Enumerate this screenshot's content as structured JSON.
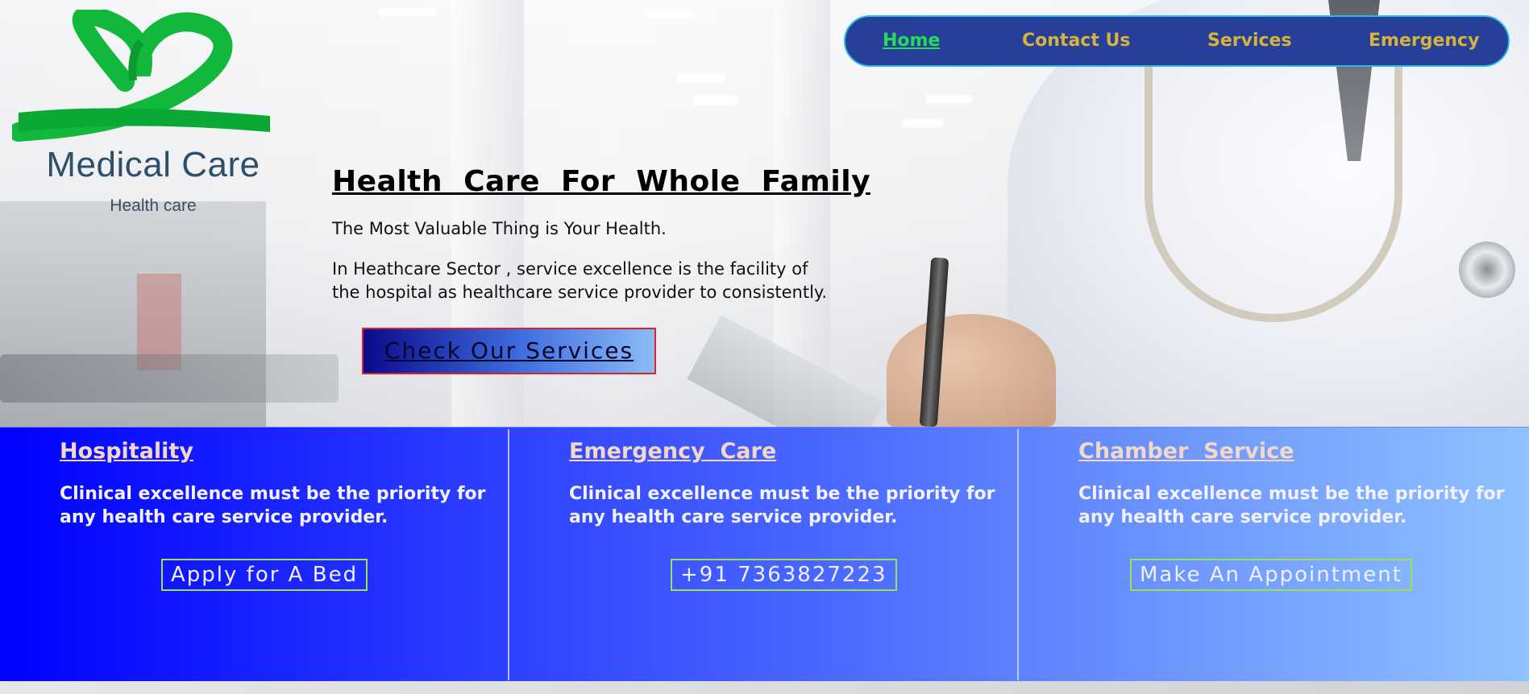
{
  "brand": {
    "title": "Medical Care",
    "subtitle": "Health care",
    "logo_icon": "heart-ribbon-icon",
    "logo_color": "#10c040"
  },
  "nav": {
    "items": [
      {
        "label": "Home",
        "active": true
      },
      {
        "label": "Contact Us",
        "active": false
      },
      {
        "label": "Services",
        "active": false
      },
      {
        "label": "Emergency",
        "active": false
      }
    ],
    "bg_color": "#283f9a",
    "border_color": "#27bde6",
    "text_color": "#d4b43a",
    "active_color": "#22dd55"
  },
  "hero": {
    "title": "Health  Care  For  Whole  Family",
    "tagline": "The Most Valuable Thing is Your Health.",
    "description": "In Heathcare Sector , service excellence is the facility of the hospital as healthcare service provider to consistently.",
    "cta_label": "Check Our Services"
  },
  "features": [
    {
      "heading": "Hospitality",
      "text": "Clinical excellence must be the priority for any health care service provider.",
      "cta": "Apply for A Bed"
    },
    {
      "heading": "Emergency  Care",
      "text": "Clinical excellence must be the priority for any health care service provider.",
      "cta": "+91 7363827223"
    },
    {
      "heading": "Chamber  Service",
      "text": "Clinical excellence must be the priority for any health care service provider.",
      "cta": "Make An Appointment"
    }
  ]
}
